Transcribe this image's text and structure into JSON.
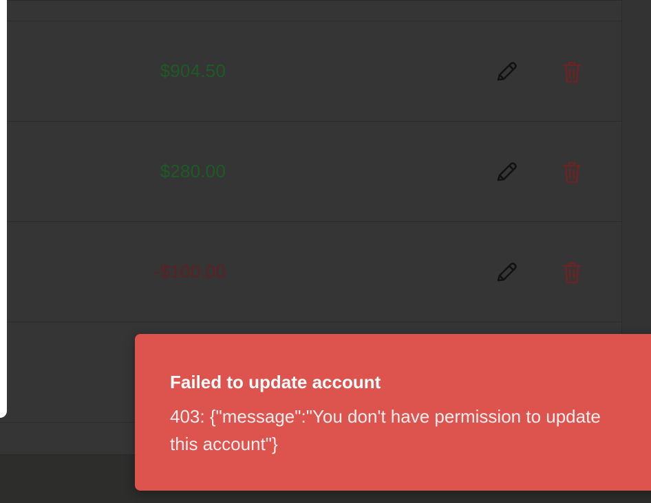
{
  "table": {
    "rows": [
      {
        "amount": "$904.50",
        "sign": "positive"
      },
      {
        "amount": "$280.00",
        "sign": "positive"
      },
      {
        "amount": "-$100.00",
        "sign": "negative"
      }
    ],
    "edit_icon": "pencil-icon",
    "delete_icon": "trash-icon"
  },
  "toast": {
    "title": "Failed to update account",
    "message": "403: {\"message\":\"You don't have permission to update this account\"}",
    "variant": "error",
    "color": "#dd534e"
  },
  "colors": {
    "positive_amount": "#1f5a26",
    "negative_amount": "#5e2022",
    "delete_icon": "#6b2426"
  }
}
